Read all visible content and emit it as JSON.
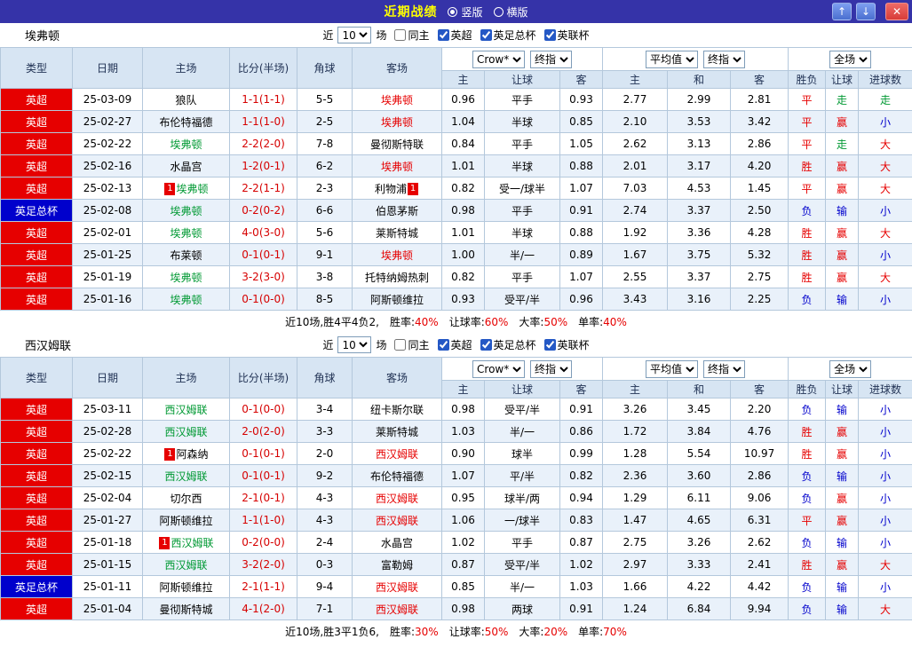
{
  "topbar": {
    "title": "近期战绩",
    "layout_options": [
      {
        "label": "竖版",
        "selected": true
      },
      {
        "label": "横版",
        "selected": false
      }
    ],
    "buttons": {
      "up": "↑",
      "down": "↓",
      "close": "✕"
    }
  },
  "filters": {
    "near_label": "近",
    "match_count": "10",
    "unit_label": "场",
    "checkboxes": [
      {
        "label": "同主",
        "checked": false
      },
      {
        "label": "英超",
        "checked": true
      },
      {
        "label": "英足总杯",
        "checked": true
      },
      {
        "label": "英联杯",
        "checked": true
      }
    ]
  },
  "table_header": {
    "selects": {
      "odds_source": "Crow*",
      "final1": "终指",
      "average": "平均值",
      "final2": "终指",
      "fulltime": "全场"
    },
    "cols": {
      "type": "类型",
      "date": "日期",
      "home": "主场",
      "score": "比分(半场)",
      "corner": "角球",
      "away": "客场",
      "h": "主",
      "handicap": "让球",
      "a": "客",
      "avg_h": "主",
      "avg_d": "和",
      "avg_a": "客",
      "wdl": "胜负",
      "handicap_result": "让球",
      "goals": "进球数"
    }
  },
  "colors": {
    "red": "#e60000",
    "blue": "#0000cc",
    "green": "#009933",
    "league_red_bg": "#e60000",
    "league_blue_bg": "#0000cc",
    "topbar_bg": "#3533a8",
    "title_yellow": "#ffff00"
  },
  "sections": [
    {
      "team": "埃弗顿",
      "rows": [
        {
          "type": "英超",
          "type_cls": "red",
          "date": "25-03-09",
          "home": {
            "name": "狼队",
            "c": "black"
          },
          "score": "1-1(1-1)",
          "corner": "5-5",
          "away": {
            "name": "埃弗顿",
            "c": "red"
          },
          "odds": [
            "0.96",
            "平手",
            "0.93"
          ],
          "avg": [
            "2.77",
            "2.99",
            "2.81"
          ],
          "res": [
            [
              "平",
              "red"
            ],
            [
              "走",
              "green"
            ],
            [
              "走",
              "green"
            ]
          ]
        },
        {
          "type": "英超",
          "type_cls": "red",
          "date": "25-02-27",
          "home": {
            "name": "布伦特福德",
            "c": "black"
          },
          "score": "1-1(1-0)",
          "corner": "2-5",
          "away": {
            "name": "埃弗顿",
            "c": "red"
          },
          "odds": [
            "1.04",
            "半球",
            "0.85"
          ],
          "avg": [
            "2.10",
            "3.53",
            "3.42"
          ],
          "res": [
            [
              "平",
              "red"
            ],
            [
              "赢",
              "red"
            ],
            [
              "小",
              "blue"
            ]
          ]
        },
        {
          "type": "英超",
          "type_cls": "red",
          "date": "25-02-22",
          "home": {
            "name": "埃弗顿",
            "c": "green"
          },
          "score": "2-2(2-0)",
          "corner": "7-8",
          "away": {
            "name": "曼彻斯特联",
            "c": "black"
          },
          "odds": [
            "0.84",
            "平手",
            "1.05"
          ],
          "avg": [
            "2.62",
            "3.13",
            "2.86"
          ],
          "res": [
            [
              "平",
              "red"
            ],
            [
              "走",
              "green"
            ],
            [
              "大",
              "red"
            ]
          ]
        },
        {
          "type": "英超",
          "type_cls": "red",
          "date": "25-02-16",
          "home": {
            "name": "水晶宫",
            "c": "black"
          },
          "score": "1-2(0-1)",
          "corner": "6-2",
          "away": {
            "name": "埃弗顿",
            "c": "red"
          },
          "odds": [
            "1.01",
            "半球",
            "0.88"
          ],
          "avg": [
            "2.01",
            "3.17",
            "4.20"
          ],
          "res": [
            [
              "胜",
              "red"
            ],
            [
              "赢",
              "red"
            ],
            [
              "大",
              "red"
            ]
          ]
        },
        {
          "type": "英超",
          "type_cls": "red",
          "date": "25-02-13",
          "home": {
            "name": "埃弗顿",
            "c": "green",
            "badge": "before"
          },
          "score": "2-2(1-1)",
          "corner": "2-3",
          "away": {
            "name": "利物浦",
            "c": "black",
            "badge": "after"
          },
          "odds": [
            "0.82",
            "受一/球半",
            "1.07"
          ],
          "avg": [
            "7.03",
            "4.53",
            "1.45"
          ],
          "res": [
            [
              "平",
              "red"
            ],
            [
              "赢",
              "red"
            ],
            [
              "大",
              "red"
            ]
          ]
        },
        {
          "type": "英足总杯",
          "type_cls": "blue",
          "date": "25-02-08",
          "home": {
            "name": "埃弗顿",
            "c": "green"
          },
          "score": "0-2(0-2)",
          "corner": "6-6",
          "away": {
            "name": "伯恩茅斯",
            "c": "black"
          },
          "odds": [
            "0.98",
            "平手",
            "0.91"
          ],
          "avg": [
            "2.74",
            "3.37",
            "2.50"
          ],
          "res": [
            [
              "负",
              "blue"
            ],
            [
              "输",
              "blue"
            ],
            [
              "小",
              "blue"
            ]
          ]
        },
        {
          "type": "英超",
          "type_cls": "red",
          "date": "25-02-01",
          "home": {
            "name": "埃弗顿",
            "c": "green"
          },
          "score": "4-0(3-0)",
          "corner": "5-6",
          "away": {
            "name": "莱斯特城",
            "c": "black"
          },
          "odds": [
            "1.01",
            "半球",
            "0.88"
          ],
          "avg": [
            "1.92",
            "3.36",
            "4.28"
          ],
          "res": [
            [
              "胜",
              "red"
            ],
            [
              "赢",
              "red"
            ],
            [
              "大",
              "red"
            ]
          ]
        },
        {
          "type": "英超",
          "type_cls": "red",
          "date": "25-01-25",
          "home": {
            "name": "布莱顿",
            "c": "black"
          },
          "score": "0-1(0-1)",
          "corner": "9-1",
          "away": {
            "name": "埃弗顿",
            "c": "red"
          },
          "odds": [
            "1.00",
            "半/一",
            "0.89"
          ],
          "avg": [
            "1.67",
            "3.75",
            "5.32"
          ],
          "res": [
            [
              "胜",
              "red"
            ],
            [
              "赢",
              "red"
            ],
            [
              "小",
              "blue"
            ]
          ]
        },
        {
          "type": "英超",
          "type_cls": "red",
          "date": "25-01-19",
          "home": {
            "name": "埃弗顿",
            "c": "green"
          },
          "score": "3-2(3-0)",
          "corner": "3-8",
          "away": {
            "name": "托特纳姆热刺",
            "c": "black"
          },
          "odds": [
            "0.82",
            "平手",
            "1.07"
          ],
          "avg": [
            "2.55",
            "3.37",
            "2.75"
          ],
          "res": [
            [
              "胜",
              "red"
            ],
            [
              "赢",
              "red"
            ],
            [
              "大",
              "red"
            ]
          ]
        },
        {
          "type": "英超",
          "type_cls": "red",
          "date": "25-01-16",
          "home": {
            "name": "埃弗顿",
            "c": "green"
          },
          "score": "0-1(0-0)",
          "corner": "8-5",
          "away": {
            "name": "阿斯顿维拉",
            "c": "black"
          },
          "odds": [
            "0.93",
            "受平/半",
            "0.96"
          ],
          "avg": [
            "3.43",
            "3.16",
            "2.25"
          ],
          "res": [
            [
              "负",
              "blue"
            ],
            [
              "输",
              "blue"
            ],
            [
              "小",
              "blue"
            ]
          ]
        }
      ],
      "summary": {
        "prefix": "近10场,胜4平4负2,",
        "stats": [
          {
            "label": "胜率:",
            "value": "40%"
          },
          {
            "label": "让球率:",
            "value": "60%"
          },
          {
            "label": "大率:",
            "value": "50%"
          },
          {
            "label": "单率:",
            "value": "40%"
          }
        ]
      }
    },
    {
      "team": "西汉姆联",
      "rows": [
        {
          "type": "英超",
          "type_cls": "red",
          "date": "25-03-11",
          "home": {
            "name": "西汉姆联",
            "c": "green"
          },
          "score": "0-1(0-0)",
          "corner": "3-4",
          "away": {
            "name": "纽卡斯尔联",
            "c": "black"
          },
          "odds": [
            "0.98",
            "受平/半",
            "0.91"
          ],
          "avg": [
            "3.26",
            "3.45",
            "2.20"
          ],
          "res": [
            [
              "负",
              "blue"
            ],
            [
              "输",
              "blue"
            ],
            [
              "小",
              "blue"
            ]
          ]
        },
        {
          "type": "英超",
          "type_cls": "red",
          "date": "25-02-28",
          "home": {
            "name": "西汉姆联",
            "c": "green"
          },
          "score": "2-0(2-0)",
          "corner": "3-3",
          "away": {
            "name": "莱斯特城",
            "c": "black"
          },
          "odds": [
            "1.03",
            "半/一",
            "0.86"
          ],
          "avg": [
            "1.72",
            "3.84",
            "4.76"
          ],
          "res": [
            [
              "胜",
              "red"
            ],
            [
              "赢",
              "red"
            ],
            [
              "小",
              "blue"
            ]
          ]
        },
        {
          "type": "英超",
          "type_cls": "red",
          "date": "25-02-22",
          "home": {
            "name": "阿森纳",
            "c": "black",
            "badge": "before"
          },
          "score": "0-1(0-1)",
          "corner": "2-0",
          "away": {
            "name": "西汉姆联",
            "c": "red"
          },
          "odds": [
            "0.90",
            "球半",
            "0.99"
          ],
          "avg": [
            "1.28",
            "5.54",
            "10.97"
          ],
          "res": [
            [
              "胜",
              "red"
            ],
            [
              "赢",
              "red"
            ],
            [
              "小",
              "blue"
            ]
          ]
        },
        {
          "type": "英超",
          "type_cls": "red",
          "date": "25-02-15",
          "home": {
            "name": "西汉姆联",
            "c": "green"
          },
          "score": "0-1(0-1)",
          "corner": "9-2",
          "away": {
            "name": "布伦特福德",
            "c": "black"
          },
          "odds": [
            "1.07",
            "平/半",
            "0.82"
          ],
          "avg": [
            "2.36",
            "3.60",
            "2.86"
          ],
          "res": [
            [
              "负",
              "blue"
            ],
            [
              "输",
              "blue"
            ],
            [
              "小",
              "blue"
            ]
          ]
        },
        {
          "type": "英超",
          "type_cls": "red",
          "date": "25-02-04",
          "home": {
            "name": "切尔西",
            "c": "black"
          },
          "score": "2-1(0-1)",
          "corner": "4-3",
          "away": {
            "name": "西汉姆联",
            "c": "red"
          },
          "odds": [
            "0.95",
            "球半/两",
            "0.94"
          ],
          "avg": [
            "1.29",
            "6.11",
            "9.06"
          ],
          "res": [
            [
              "负",
              "blue"
            ],
            [
              "赢",
              "red"
            ],
            [
              "小",
              "blue"
            ]
          ]
        },
        {
          "type": "英超",
          "type_cls": "red",
          "date": "25-01-27",
          "home": {
            "name": "阿斯顿维拉",
            "c": "black"
          },
          "score": "1-1(1-0)",
          "corner": "4-3",
          "away": {
            "name": "西汉姆联",
            "c": "red"
          },
          "odds": [
            "1.06",
            "一/球半",
            "0.83"
          ],
          "avg": [
            "1.47",
            "4.65",
            "6.31"
          ],
          "res": [
            [
              "平",
              "red"
            ],
            [
              "赢",
              "red"
            ],
            [
              "小",
              "blue"
            ]
          ]
        },
        {
          "type": "英超",
          "type_cls": "red",
          "date": "25-01-18",
          "home": {
            "name": "西汉姆联",
            "c": "green",
            "badge": "before"
          },
          "score": "0-2(0-0)",
          "corner": "2-4",
          "away": {
            "name": "水晶宫",
            "c": "black"
          },
          "odds": [
            "1.02",
            "平手",
            "0.87"
          ],
          "avg": [
            "2.75",
            "3.26",
            "2.62"
          ],
          "res": [
            [
              "负",
              "blue"
            ],
            [
              "输",
              "blue"
            ],
            [
              "小",
              "blue"
            ]
          ]
        },
        {
          "type": "英超",
          "type_cls": "red",
          "date": "25-01-15",
          "home": {
            "name": "西汉姆联",
            "c": "green"
          },
          "score": "3-2(2-0)",
          "corner": "0-3",
          "away": {
            "name": "富勒姆",
            "c": "black"
          },
          "odds": [
            "0.87",
            "受平/半",
            "1.02"
          ],
          "avg": [
            "2.97",
            "3.33",
            "2.41"
          ],
          "res": [
            [
              "胜",
              "red"
            ],
            [
              "赢",
              "red"
            ],
            [
              "大",
              "red"
            ]
          ]
        },
        {
          "type": "英足总杯",
          "type_cls": "blue",
          "date": "25-01-11",
          "home": {
            "name": "阿斯顿维拉",
            "c": "black"
          },
          "score": "2-1(1-1)",
          "corner": "9-4",
          "away": {
            "name": "西汉姆联",
            "c": "red"
          },
          "odds": [
            "0.85",
            "半/一",
            "1.03"
          ],
          "avg": [
            "1.66",
            "4.22",
            "4.42"
          ],
          "res": [
            [
              "负",
              "blue"
            ],
            [
              "输",
              "blue"
            ],
            [
              "小",
              "blue"
            ]
          ]
        },
        {
          "type": "英超",
          "type_cls": "red",
          "date": "25-01-04",
          "home": {
            "name": "曼彻斯特城",
            "c": "black"
          },
          "score": "4-1(2-0)",
          "corner": "7-1",
          "away": {
            "name": "西汉姆联",
            "c": "red"
          },
          "odds": [
            "0.98",
            "两球",
            "0.91"
          ],
          "avg": [
            "1.24",
            "6.84",
            "9.94"
          ],
          "res": [
            [
              "负",
              "blue"
            ],
            [
              "输",
              "blue"
            ],
            [
              "大",
              "red"
            ]
          ]
        }
      ],
      "summary": {
        "prefix": "近10场,胜3平1负6,",
        "stats": [
          {
            "label": "胜率:",
            "value": "30%"
          },
          {
            "label": "让球率:",
            "value": "50%"
          },
          {
            "label": "大率:",
            "value": "20%"
          },
          {
            "label": "单率:",
            "value": "70%"
          }
        ]
      }
    }
  ]
}
